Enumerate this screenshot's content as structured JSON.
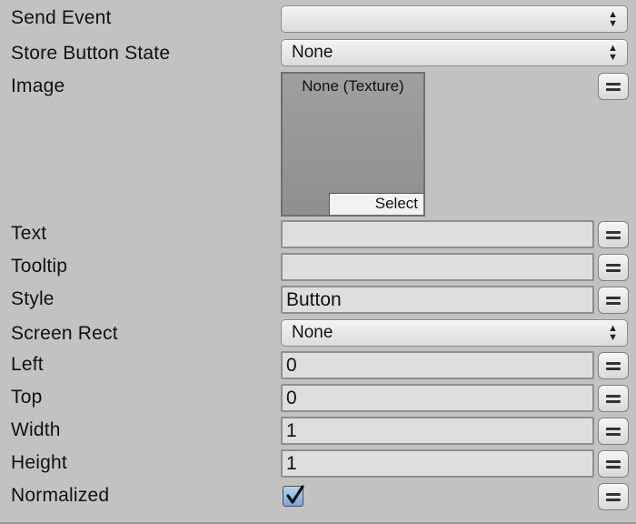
{
  "fields": {
    "send_event": {
      "label": "Send Event",
      "value": ""
    },
    "store_button_state": {
      "label": "Store Button State",
      "value": "None"
    },
    "image": {
      "label": "Image",
      "texture_name": "None (Texture)",
      "select_label": "Select"
    },
    "text": {
      "label": "Text",
      "value": ""
    },
    "tooltip": {
      "label": "Tooltip",
      "value": ""
    },
    "style": {
      "label": "Style",
      "value": "Button"
    },
    "screen_rect": {
      "label": "Screen Rect",
      "value": "None"
    },
    "left": {
      "label": "Left",
      "value": "0"
    },
    "top": {
      "label": "Top",
      "value": "0"
    },
    "width": {
      "label": "Width",
      "value": "1"
    },
    "height": {
      "label": "Height",
      "value": "1"
    },
    "normalized": {
      "label": "Normalized",
      "checked": true
    }
  },
  "icons": {
    "dropdown_arrows": "updown-arrows-icon",
    "variable_toggle": "equals-icon",
    "checkmark": "checkmark-icon"
  },
  "colors": {
    "background": "#c2c2c2",
    "field_background": "#dedede",
    "checkbox_fill": "#7ba4d6"
  }
}
